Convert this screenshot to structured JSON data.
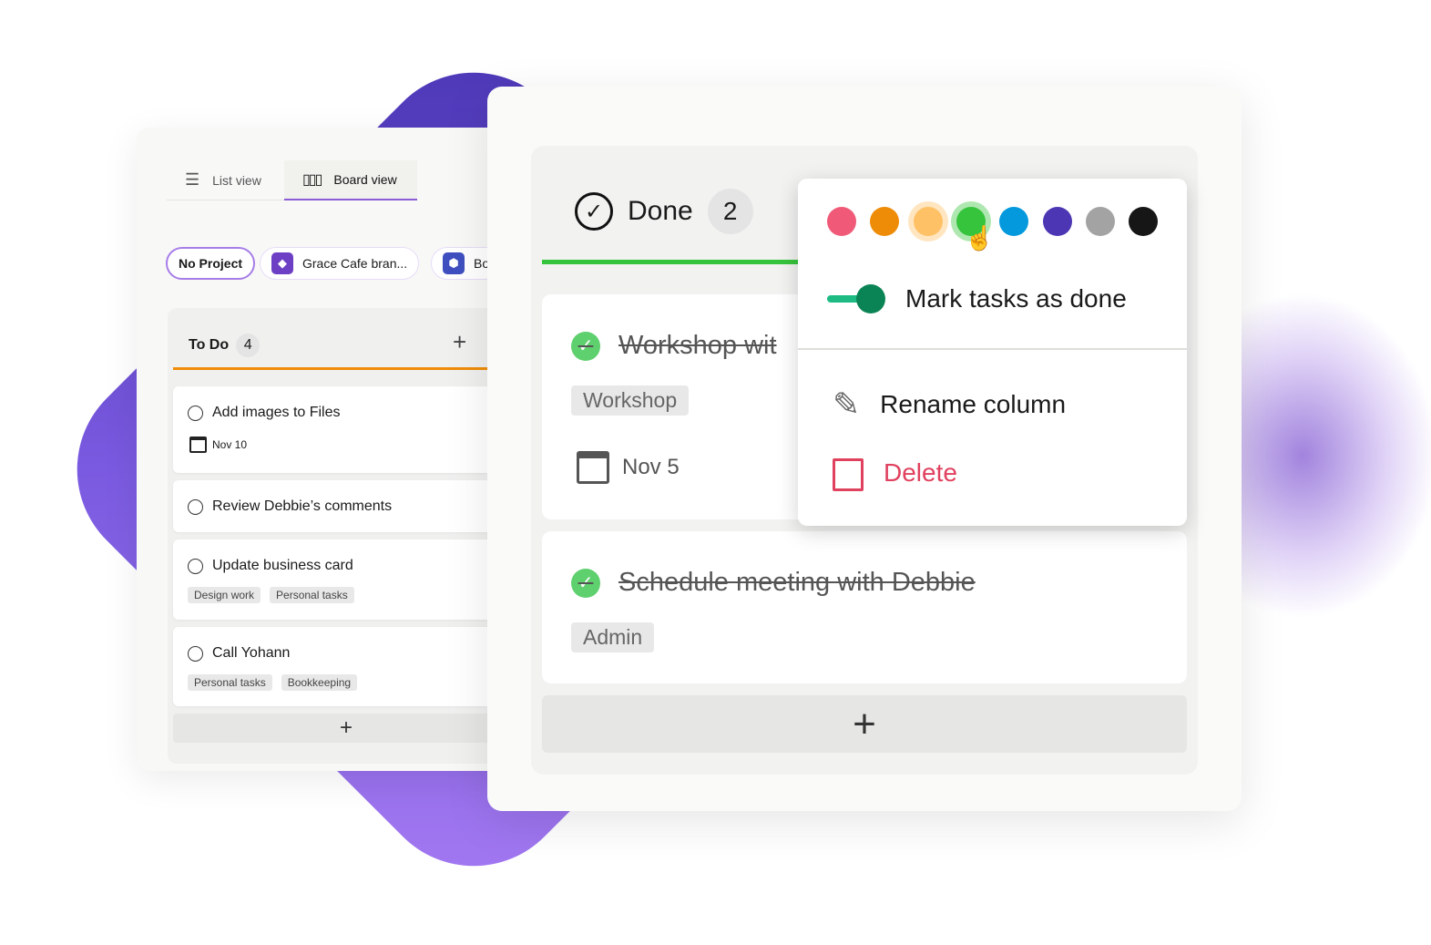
{
  "left_panel": {
    "tabs": [
      {
        "label": "List view",
        "icon": "list-icon"
      },
      {
        "label": "Board view",
        "icon": "board-icon",
        "active": true
      }
    ],
    "projects": [
      {
        "label": "No Project",
        "selected": true
      },
      {
        "label": "Grace Cafe bran...",
        "icon": "diamond-icon",
        "color": "#6c3fc4"
      },
      {
        "label": "Bo",
        "icon": "hexagon-icon",
        "color": "#3f4fc0"
      }
    ],
    "column": {
      "title": "To Do",
      "count": "4",
      "accent": "#ef8d0a",
      "add": "+",
      "cards": [
        {
          "title": "Add images to Files",
          "date": "Nov 10",
          "tags": []
        },
        {
          "title": "Review Debbie’s comments",
          "tags": []
        },
        {
          "title": "Update business card",
          "tags": [
            "Design work",
            "Personal tasks"
          ]
        },
        {
          "title": "Call Yohann",
          "tags": [
            "Personal tasks",
            "Bookkeeping"
          ]
        }
      ],
      "add_card": "+"
    }
  },
  "done_column": {
    "title": "Done",
    "count": "2",
    "accent": "#36c43c",
    "cards": [
      {
        "title": "Workshop wit",
        "tag": "Workshop",
        "date": "Nov 5",
        "done": true
      },
      {
        "title": "Schedule meeting with Debbie",
        "tag": "Admin",
        "done": true
      }
    ],
    "add_card": "+"
  },
  "menu": {
    "colors": [
      "#f05a78",
      "#ee8c07",
      "#ffc165",
      "#36c43c",
      "#0399dc",
      "#4c36b3",
      "#a3a3a3",
      "#161616"
    ],
    "selected_color": "#36c43c",
    "toggle": {
      "label": "Mark tasks as done",
      "on": true
    },
    "rename": "Rename column",
    "delete": "Delete",
    "delete_color": "#e0415e"
  }
}
